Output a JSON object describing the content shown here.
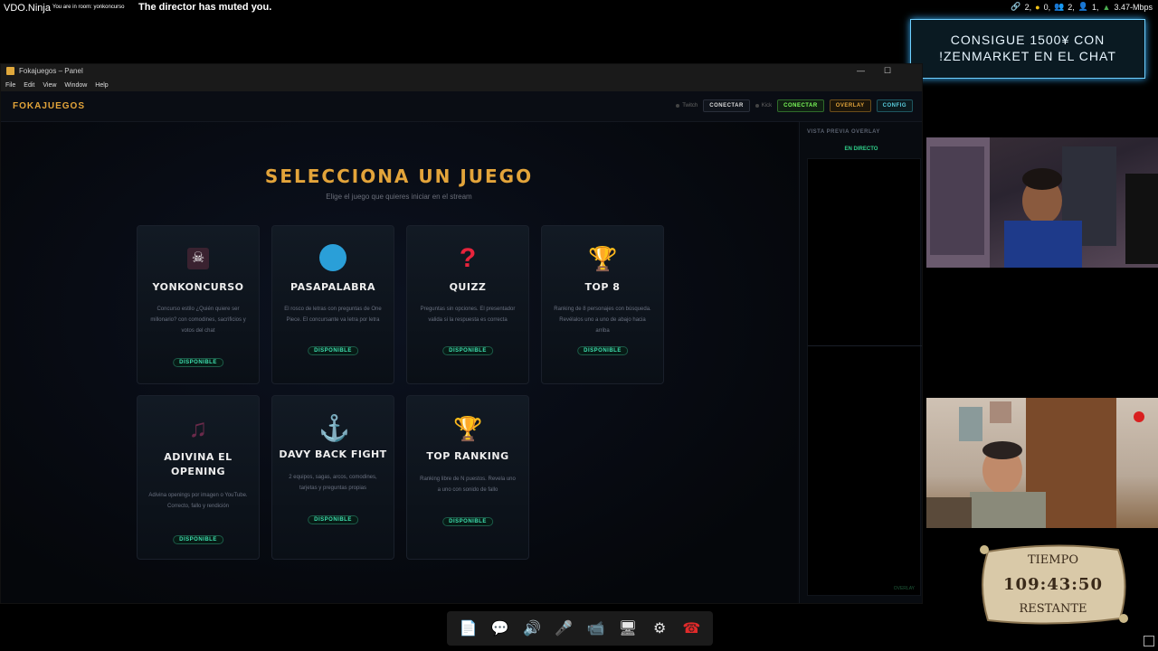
{
  "topbar": {
    "brand": "VDO.Ninja",
    "room": "You are in room: yonkoncurso",
    "muted": "The director has muted you.",
    "stats": {
      "links": "2,",
      "a": "0,",
      "b": "2,",
      "c": "1,",
      "bitrate": "3.47-Mbps"
    }
  },
  "promo": {
    "line1": "CONSIGUE 1500¥ CON",
    "line2": "!ZENMARKET EN EL CHAT"
  },
  "window": {
    "title": "Fokajuegos – Panel",
    "menu": [
      "File",
      "Edit",
      "View",
      "Window",
      "Help"
    ]
  },
  "header": {
    "logo": "FOKAJUEGOS",
    "twitch_label": "Twitch",
    "twitch_btn": "CONECTAR",
    "kick_label": "Kick",
    "kick_btn": "CONECTAR",
    "overlay_btn": "OVERLAY",
    "config_btn": "CONFIG"
  },
  "main": {
    "title": "SELECCIONA UN JUEGO",
    "subtitle": "Elige el juego que quieres iniciar en el stream",
    "cards": [
      {
        "icon": "skull-crossbones-icon",
        "title": "YONKONCURSO",
        "desc": "Concurso estilo ¿Quién quiere ser millonario? con comodines, sacrificios y votos del chat",
        "badge": "DISPONIBLE"
      },
      {
        "icon": "blue-circle-icon",
        "title": "PASAPALABRA",
        "desc": "El rosco de letras con preguntas de One Piece. El concursante va letra por letra",
        "badge": "DISPONIBLE"
      },
      {
        "icon": "question-mark-icon",
        "title": "QUIZZ",
        "desc": "Preguntas sin opciones. El presentador valida si la respuesta es correcta",
        "badge": "DISPONIBLE"
      },
      {
        "icon": "trophy-icon",
        "title": "TOP 8",
        "desc": "Ranking de 8 personajes con búsqueda. Revélalos uno a uno de abajo hacia arriba",
        "badge": "DISPONIBLE"
      },
      {
        "icon": "music-note-icon",
        "title": "ADIVINA EL OPENING",
        "desc": "Adivina openings por imagen o YouTube. Correcto, fallo y rendición",
        "badge": "DISPONIBLE"
      },
      {
        "icon": "anchor-icon",
        "title": "DAVY BACK FIGHT",
        "desc": "2 equipos, sagas, arcos, comodines, tarjetas y preguntas propias",
        "badge": "DISPONIBLE"
      },
      {
        "icon": "trophy-icon",
        "title": "TOP RANKING",
        "desc": "Ranking libre de N puestos. Revela uno a uno con sonido de fallo",
        "badge": "DISPONIBLE"
      }
    ]
  },
  "side": {
    "title": "VISTA PREVIA OVERLAY",
    "live": "EN DIRECTO",
    "footer": "OVERLAY"
  },
  "timer": {
    "label_top": "TIEMPO",
    "value": "109:43:50",
    "label_bottom": "RESTANTE"
  },
  "toolbar": [
    "file-upload-icon",
    "chat-icon",
    "speaker-icon",
    "microphone-icon",
    "camera-icon",
    "screen-share-icon",
    "settings-icon",
    "hang-up-icon"
  ]
}
